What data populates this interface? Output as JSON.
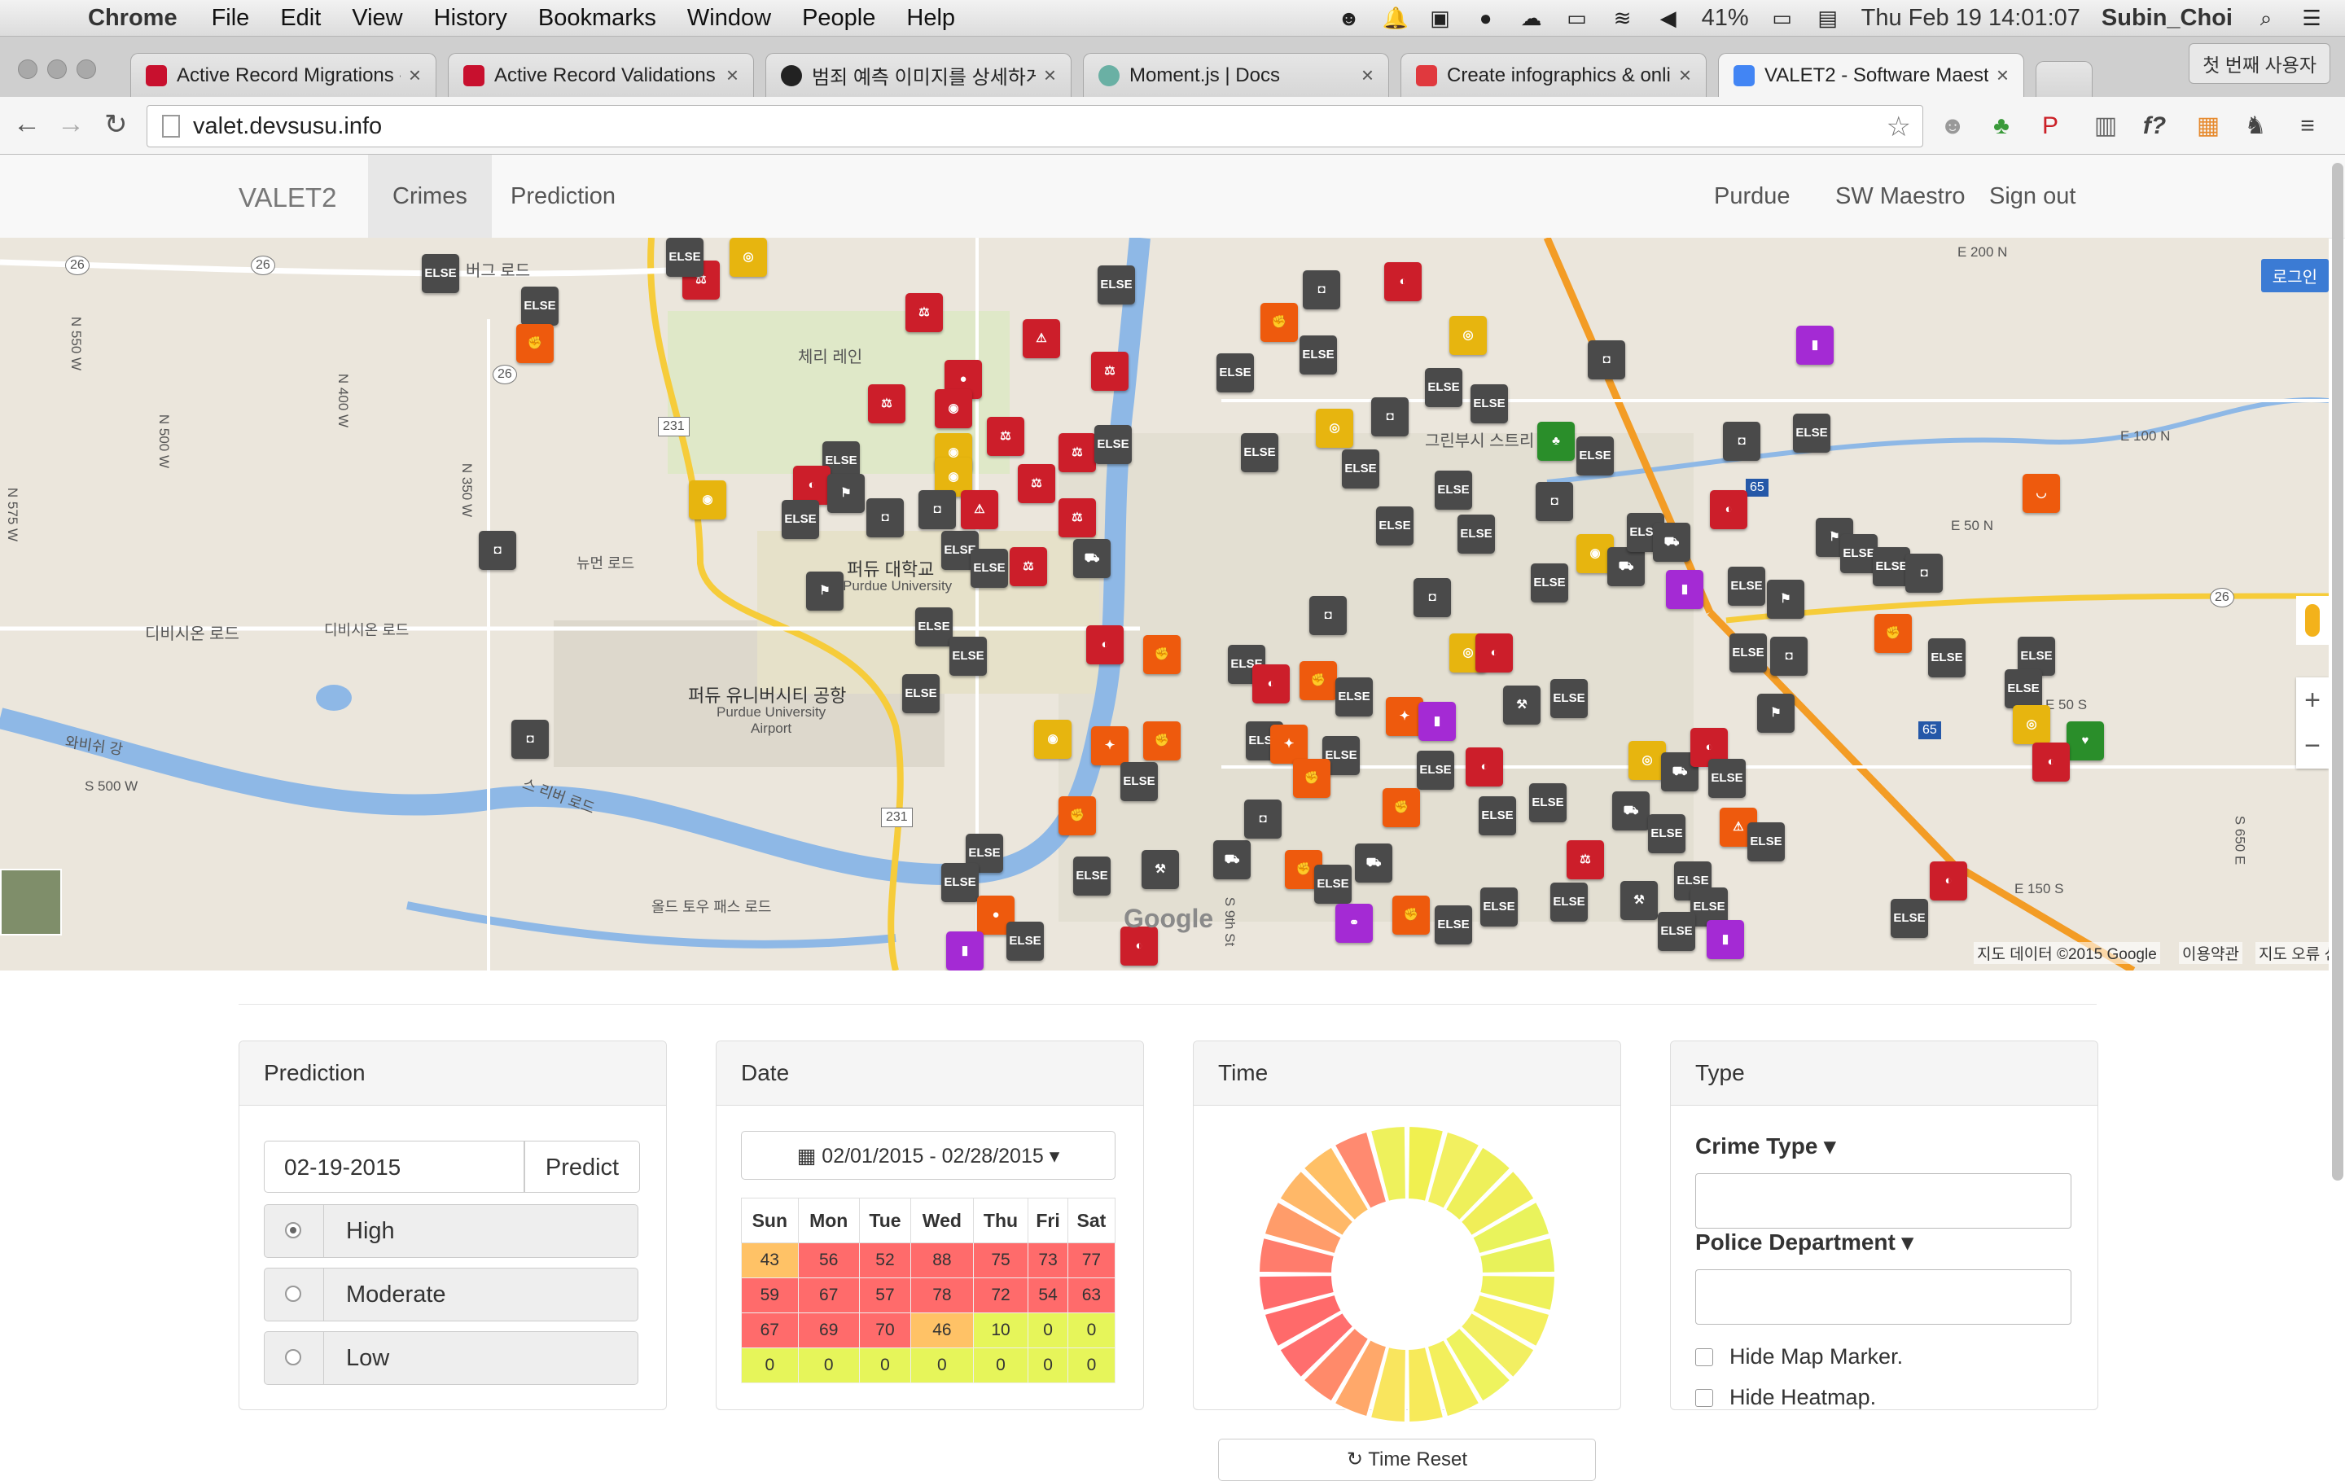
{
  "menubar": {
    "app": "Chrome",
    "items": [
      "File",
      "Edit",
      "View",
      "History",
      "Bookmarks",
      "Window",
      "People",
      "Help"
    ],
    "battery": "41%",
    "clock": "Thu Feb 19  14:01:07",
    "user": "Subin_Choi"
  },
  "tabs": [
    {
      "title": "Active Record Migrations -",
      "favicon_color": "#c8102e"
    },
    {
      "title": "Active Record Validations -",
      "favicon_color": "#c8102e"
    },
    {
      "title": "범죄 예측 이미지를 상세하게 비",
      "favicon_color": "#222222"
    },
    {
      "title": "Moment.js | Docs",
      "favicon_color": "#6ab0a4"
    },
    {
      "title": "Create infographics & onlin",
      "favicon_color": "#e0393e"
    },
    {
      "title": "VALET2 - Software Maestr",
      "favicon_color": "#4285f4"
    }
  ],
  "profile_button": "첫 번째 사용자",
  "address_bar": {
    "url": "valet.devsusu.info"
  },
  "navbar": {
    "brand": "VALET2",
    "left_links": [
      "Crimes",
      "Prediction"
    ],
    "active": "Crimes",
    "right_links": [
      "Purdue",
      "SW Maestro",
      "Sign out"
    ]
  },
  "map": {
    "login_button": "로그인",
    "labels": {
      "purdue_univ_ko": "퍼듀 대학교",
      "purdue_univ_en": "Purdue University",
      "airport_ko": "퍼듀 유니버시티 공항",
      "airport_en": "Purdue University\nAirport",
      "cherry_lane": "체리 레인",
      "division_rd_1": "디비시온 로드",
      "division_rd_2": "디비시온 로드",
      "newman_rd": "뉴먼 로드",
      "wabash_river": "와비쉬 강",
      "berg_rd": "버그 로드",
      "greenbush": "그린부시 스트리",
      "old_toll": "올드 토우 패스 로드",
      "river_rd": "스 리버 로드",
      "s500w": "S 500 W",
      "n550w": "N 550 W",
      "n500w": "N 500 W",
      "n400w": "N 400 W",
      "n350w": "N 350 W",
      "n575w": "N 575 W",
      "e200n": "E 200 N",
      "e100n": "E 100 N",
      "e50n": "E 50 N",
      "e50s": "E 50 S",
      "e150s": "E 150 S",
      "s650e": "S 650 E",
      "s9th": "S 9th St",
      "r26a": "26",
      "r26b": "26",
      "r26c": "26",
      "r26d": "26",
      "r231a": "231",
      "r231b": "231",
      "r65a": "65",
      "r65b": "65"
    },
    "marker_text": "ELSE",
    "attribution": "지도 데이터 ©2015 Google",
    "terms": "이용약관",
    "report": "지도 오류 신고",
    "google": "Google",
    "zoom_in": "+",
    "zoom_out": "−"
  },
  "prediction_panel": {
    "title": "Prediction",
    "date_value": "02-19-2015",
    "predict_button": "Predict",
    "options": [
      "High",
      "Moderate",
      "Low"
    ],
    "selected": "High"
  },
  "date_panel": {
    "title": "Date",
    "range": "02/01/2015 - 02/28/2015",
    "days": [
      "Sun",
      "Mon",
      "Tue",
      "Wed",
      "Thu",
      "Fri",
      "Sat"
    ],
    "rows": [
      [
        43,
        56,
        52,
        88,
        75,
        73,
        77
      ],
      [
        59,
        67,
        57,
        78,
        72,
        54,
        63
      ],
      [
        67,
        69,
        70,
        46,
        10,
        0,
        0
      ],
      [
        0,
        0,
        0,
        0,
        0,
        0,
        0
      ]
    ],
    "colors": {
      "high": "#ff6b6b",
      "mid": "#ffc266",
      "low": "#e6f55a",
      "lowmid": "#f0f060"
    }
  },
  "time_panel": {
    "title": "Time",
    "reset_button": "Time Reset",
    "segments": 24
  },
  "type_panel": {
    "title": "Type",
    "crime_type_label": "Crime Type",
    "police_dept_label": "Police Department",
    "hide_marker": "Hide Map Marker.",
    "hide_heatmap": "Hide Heatmap."
  }
}
